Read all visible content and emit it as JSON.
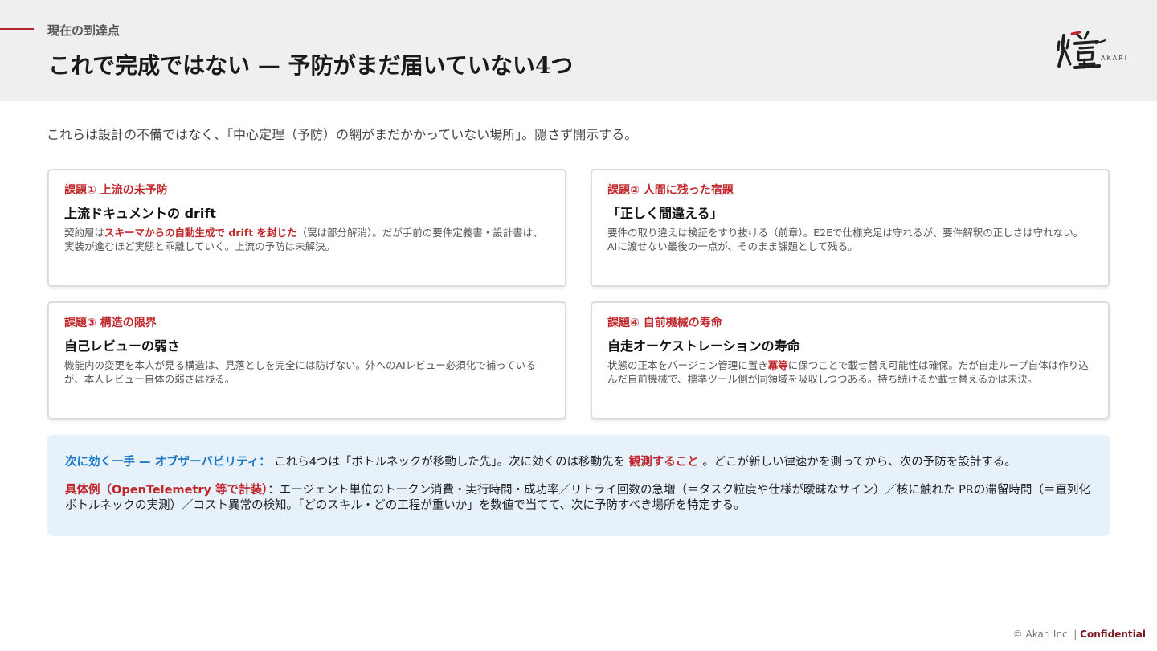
{
  "header": {
    "section_label": "現在の到達点",
    "title": "これで完成ではない — 予防がまだ届いていない4つ",
    "logo_text": "AKARI"
  },
  "lead": "これらは設計の不備ではなく、「中心定理（予防）の網がまだかかっていない場所」。隠さず開示する。",
  "cards": [
    {
      "tag": "課題① 上流の未予防",
      "heading": "上流ドキュメントの drift",
      "body_pre": "契約層は",
      "body_hl": "スキーマからの自動生成で drift を封じた",
      "body_post": "（罠は部分解消）。だが手前の要件定義書・設計書は、実装が進むほど実態と乖離していく。上流の予防は未解決。"
    },
    {
      "tag": "課題② 人間に残った宿題",
      "heading": "「正しく間違える」",
      "body": "要件の取り違えは検証をすり抜ける（前章）。E2Eで仕様充足は守れるが、要件解釈の正しさは守れない。AIに渡せない最後の一点が、そのまま課題として残る。"
    },
    {
      "tag": "課題③ 構造の限界",
      "heading": "自己レビューの弱さ",
      "body": "機能内の変更を本人が見る構造は、見落としを完全には防げない。外へのAIレビュー必須化で補っているが、本人レビュー自体の弱さは残る。"
    },
    {
      "tag": "課題④ 自前機械の寿命",
      "heading": "自走オーケストレーションの寿命",
      "body_pre": "状態の正本をバージョン管理に置き",
      "body_hl": "冪等",
      "body_post": "に保つことで載せ替え可能性は確保。だが自走ループ自体は作り込んだ自前機械で、標準ツール側が同領域を吸収しつつある。持ち続けるか載せ替えるかは未決。"
    }
  ],
  "callout": {
    "label": "次に効く一手 — オブザーバビリティ：",
    "text_pre": "これら4つは「ボトルネックが移動した先」。次に効くのは移動先を",
    "text_hl": "観測すること",
    "text_post": "。どこが新しい律速かを測ってから、次の予防を設計する。",
    "example_label": "具体例（OpenTelemetry 等で計装）",
    "example_text": "：エージェント単位のトークン消費・実行時間・成功率／リトライ回数の急増（＝タスク粒度や仕様が曖昧なサイン）／核に触れた PRの滞留時間（＝直列化ボトルネックの実測）／コスト異常の検知。「どのスキル・どの工程が重いか」を数値で当てて、次に予防すべき場所を特定する。"
  },
  "footer": {
    "copyright": "© Akari Inc. |",
    "confidential": "Confidential"
  }
}
